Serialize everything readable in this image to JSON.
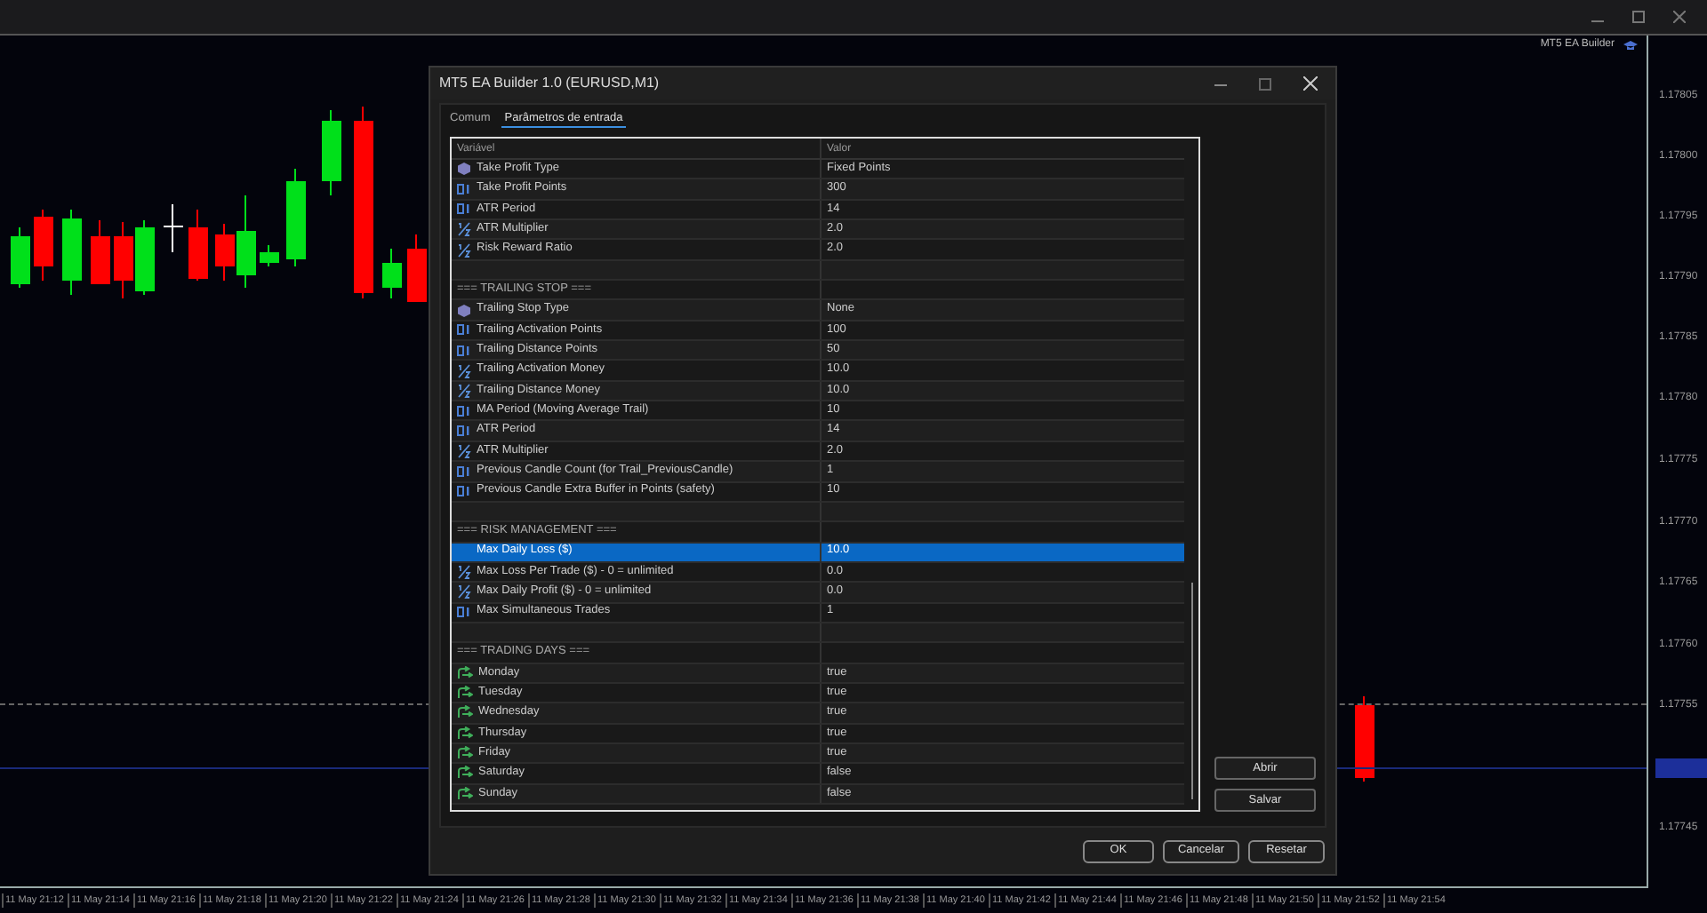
{
  "chart_window": {
    "label": "MT5 EA Builder"
  },
  "price_axis": [
    "1.17805",
    "1.17800",
    "1.17795",
    "1.17790",
    "1.17785",
    "1.17780",
    "1.17775",
    "1.17770",
    "1.17765",
    "1.17760",
    "1.17755",
    "1.17745"
  ],
  "time_axis": [
    "11 May 21:12",
    "11 May 21:14",
    "11 May 21:16",
    "11 May 21:18",
    "11 May 21:20",
    "11 May 21:22",
    "11 May 21:24",
    "11 May 21:26",
    "11 May 21:28",
    "11 May 21:30",
    "11 May 21:32",
    "11 May 21:34",
    "11 May 21:36",
    "11 May 21:38",
    "11 May 21:40",
    "11 May 21:42",
    "11 May 21:44",
    "11 May 21:46",
    "11 May 21:48",
    "11 May 21:50",
    "11 May 21:52",
    "11 May 21:54"
  ],
  "dialog": {
    "title": "MT5 EA Builder 1.0 (EURUSD,M1)",
    "tabs": [
      {
        "label": "Comum",
        "selected": false
      },
      {
        "label": "Parâmetros de entrada",
        "selected": true
      }
    ],
    "table": {
      "columns": [
        "Variável",
        "Valor"
      ],
      "rows": [
        {
          "kind": "enum",
          "name": "Take Profit Type",
          "value": "Fixed Points",
          "selected": false
        },
        {
          "kind": "int",
          "name": "Take Profit Points",
          "value": "300",
          "selected": false
        },
        {
          "kind": "int",
          "name": "ATR Period",
          "value": "14",
          "selected": false
        },
        {
          "kind": "double",
          "name": "ATR Multiplier",
          "value": "2.0",
          "selected": false
        },
        {
          "kind": "double",
          "name": "Risk Reward Ratio",
          "value": "2.0",
          "selected": false
        },
        {
          "kind": "blank",
          "selected": false
        },
        {
          "kind": "section",
          "name": "=== TRAILING STOP ===",
          "selected": false
        },
        {
          "kind": "enum",
          "name": "Trailing Stop Type",
          "value": "None",
          "selected": false
        },
        {
          "kind": "int",
          "name": "Trailing Activation Points",
          "value": "100",
          "selected": false
        },
        {
          "kind": "int",
          "name": "Trailing Distance Points",
          "value": "50",
          "selected": false
        },
        {
          "kind": "double",
          "name": "Trailing Activation Money",
          "value": "10.0",
          "selected": false
        },
        {
          "kind": "double",
          "name": "Trailing Distance Money",
          "value": "10.0",
          "selected": false
        },
        {
          "kind": "int",
          "name": "MA Period (Moving Average Trail)",
          "value": "10",
          "selected": false
        },
        {
          "kind": "int",
          "name": "ATR Period",
          "value": "14",
          "selected": false
        },
        {
          "kind": "double",
          "name": "ATR Multiplier",
          "value": "2.0",
          "selected": false
        },
        {
          "kind": "int",
          "name": "Previous Candle Count (for Trail_PreviousCandle)",
          "value": "1",
          "selected": false
        },
        {
          "kind": "int",
          "name": "Previous Candle Extra Buffer in Points (safety)",
          "value": "10",
          "selected": false
        },
        {
          "kind": "blank",
          "selected": false
        },
        {
          "kind": "section",
          "name": "=== RISK MANAGEMENT ===",
          "selected": false
        },
        {
          "kind": "double",
          "name": "Max Daily Loss ($)",
          "value": "10.0",
          "selected": true
        },
        {
          "kind": "double",
          "name": "Max Loss Per Trade ($) - 0 = unlimited",
          "value": "0.0",
          "selected": false
        },
        {
          "kind": "double",
          "name": "Max Daily Profit ($) - 0 = unlimited",
          "value": "0.0",
          "selected": false
        },
        {
          "kind": "int",
          "name": "Max Simultaneous Trades",
          "value": "1",
          "selected": false
        },
        {
          "kind": "blank",
          "selected": false
        },
        {
          "kind": "section",
          "name": "=== TRADING DAYS ===",
          "selected": false
        },
        {
          "kind": "bool",
          "name": "Monday",
          "value": "true",
          "selected": false
        },
        {
          "kind": "bool",
          "name": "Tuesday",
          "value": "true",
          "selected": false
        },
        {
          "kind": "bool",
          "name": "Wednesday",
          "value": "true",
          "selected": false
        },
        {
          "kind": "bool",
          "name": "Thursday",
          "value": "true",
          "selected": false
        },
        {
          "kind": "bool",
          "name": "Friday",
          "value": "true",
          "selected": false
        },
        {
          "kind": "bool",
          "name": "Saturday",
          "value": "false",
          "selected": false
        },
        {
          "kind": "bool",
          "name": "Sunday",
          "value": "false",
          "selected": false
        }
      ]
    },
    "side_buttons": [
      "Abrir",
      "Salvar"
    ],
    "buttons": [
      "OK",
      "Cancelar",
      "Resetar"
    ]
  }
}
